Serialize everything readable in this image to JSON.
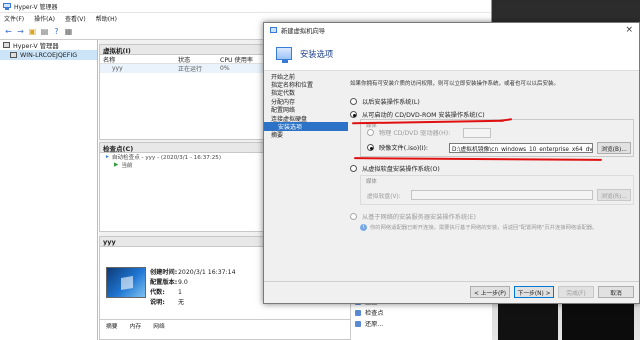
{
  "hyperv": {
    "title": "Hyper-V 管理器",
    "menu": [
      "文件(F)",
      "操作(A)",
      "查看(V)",
      "帮助(H)"
    ],
    "tree": {
      "root": "Hyper-V 管理器",
      "server": "WIN-LRCOEJQEFIG"
    },
    "vm_pane": {
      "title": "虚拟机(I)",
      "columns": [
        "名称",
        "状态",
        "CPU 使用率"
      ],
      "row": {
        "name": "yyy",
        "state": "正在运行",
        "cpu": "0%"
      }
    },
    "checkpoint_pane": {
      "title": "检查点(C)",
      "items": [
        "自动检查点 - yyy - (2020/3/1 - 16:37:25)",
        "当前"
      ]
    },
    "details": {
      "title": "yyy",
      "fields": [
        {
          "label": "创建时间:",
          "value": "2020/3/1 16:37:14"
        },
        {
          "label": "配置版本:",
          "value": "9.0"
        },
        {
          "label": "代数:",
          "value": "1"
        },
        {
          "label": "说明:",
          "value": "无"
        }
      ],
      "tabs": [
        "摘要",
        "内存",
        "网络"
      ]
    },
    "actions": [
      "重置",
      "检查点",
      "还原..."
    ]
  },
  "wizard": {
    "title": "新建虚拟机向导",
    "close": "×",
    "header": "安装选项",
    "nav": [
      "开始之前",
      "指定名称和位置",
      "指定代数",
      "分配内存",
      "配置网络",
      "连接虚拟硬盘",
      "安装选项",
      "摘要"
    ],
    "current_step": 6,
    "description": "如果你拥有可安装介质的访问权限，则可以立即安装操作系统，或者也可以以后安装。",
    "options": {
      "later": "以后安装操作系统(L)",
      "bootable_cd": "从可启动的 CD/DVD-ROM 安装操作系统(C)",
      "media_label": "媒体",
      "physical_drive": "物理 CD/DVD 驱动器(H):",
      "image_file": "映像文件(.iso)(I):",
      "iso_path": "D:\\虚拟机镜像\\cn_windows_10_enterprise_x64_dvd_6",
      "browse": "浏览(B)...",
      "floppy": "从虚拟软盘安装操作系统(O)",
      "floppy_media": "媒体",
      "virtual_floppy": "虚拟软盘(V):",
      "browse2": "浏览(R)...",
      "network": "从基于网络的安装服务器安装操作系统(E)",
      "network_note": "你的网络适配器已断开连接。需要执行基于网络的安装，请返回\"配置网络\"页并连接网络适配器。"
    },
    "buttons": {
      "prev": "< 上一步(P)",
      "next": "下一步(N) >",
      "finish": "完成(F)",
      "cancel": "取消"
    }
  },
  "colors": {
    "accent": "#2c72c7",
    "annotation_red": "#e01010"
  }
}
